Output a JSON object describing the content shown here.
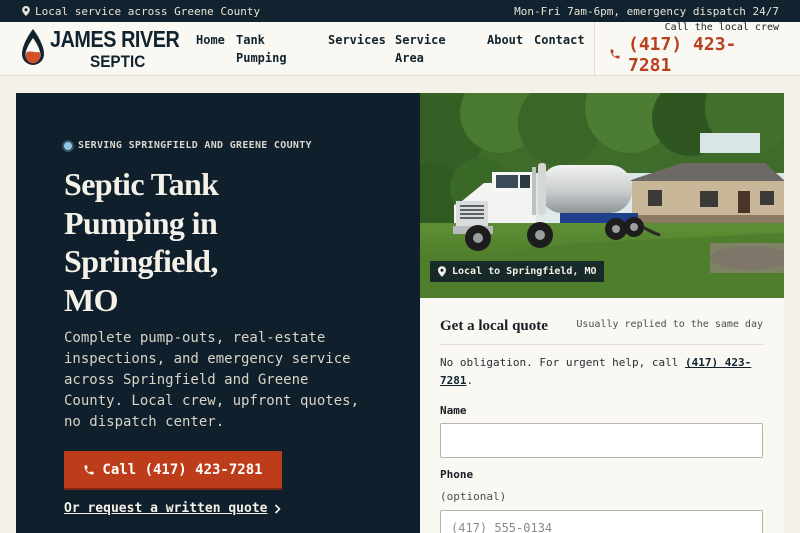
{
  "topbar": {
    "left_text": "Local service across Greene County",
    "right_text": "Mon-Fri 7am-6pm, emergency dispatch 24/7"
  },
  "brand": {
    "line1": "JAMES RIVER",
    "line2": "SEPTIC"
  },
  "nav": {
    "home": "Home",
    "tank_pumping": "Tank Pumping",
    "services": "Services",
    "service_area": "Service Area",
    "about": "About",
    "contact": "Contact"
  },
  "header_call": {
    "label": "Call the local crew",
    "phone": "(417) 423-7281"
  },
  "hero": {
    "eyebrow": "SERVING SPRINGFIELD AND GREENE COUNTY",
    "title": "Septic Tank Pumping in Springfield, MO",
    "lede": "Complete pump-outs, real-estate inspections, and emergency service across Springfield and Greene County. Local crew, upfront quotes, no dispatch center.",
    "cta_label": "Call (417) 423-7281",
    "secondary_link": "Or request a written quote"
  },
  "photo": {
    "badge": "Local to Springfield, MO"
  },
  "quote_form": {
    "title": "Get a local quote",
    "subtitle": "Usually replied to the same day",
    "note_prefix": "No obligation. For urgent help, call",
    "note_phone": "(417) 423-7281",
    "note_suffix": ".",
    "name_label": "Name",
    "name_value": "",
    "phone_label": "Phone",
    "phone_hint": "(optional)",
    "phone_placeholder": "(417) 555-0134"
  },
  "colors": {
    "navy": "#0f1f2b",
    "accent": "#bd3d1b",
    "cream": "#f4f1e8"
  },
  "icons": {
    "topbar": "map-pin-icon",
    "logo": "water-drop-icon",
    "phone": "phone-icon",
    "eyebrow": "status-dot-icon",
    "link": "chevron-right-icon"
  }
}
